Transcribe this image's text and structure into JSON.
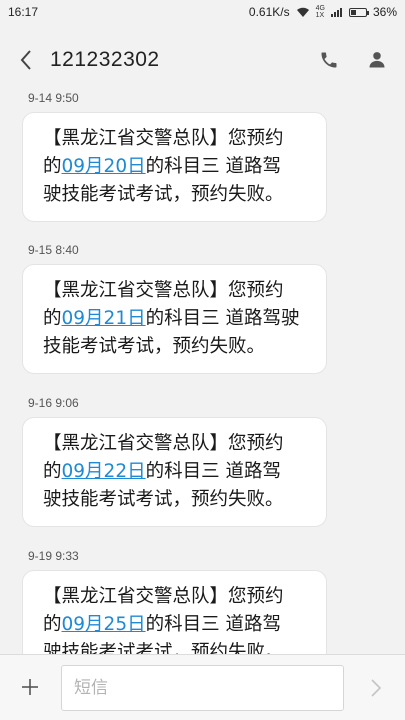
{
  "status_bar": {
    "time": "16:17",
    "net_speed": "0.61K/s",
    "net_type_top": "4G",
    "net_type_bottom": "1X",
    "battery": "36%",
    "battery_level": 0.36
  },
  "header": {
    "back_icon": "chevron-left-icon",
    "contact_number": "121232302",
    "call_icon": "phone-icon",
    "contact_icon": "person-icon"
  },
  "messages": [
    {
      "time": "9-14 9:50",
      "lines": [
        [
          "【黑龙江省交警总队】您预约"
        ],
        [
          "的",
          "09月20日",
          "的科目三 道路驾"
        ],
        [
          "驶技能考试考试，预约失败。"
        ]
      ]
    },
    {
      "time": "9-15 8:40",
      "lines": [
        [
          "【黑龙江省交警总队】您预约"
        ],
        [
          "的",
          "09月21日",
          "的科目三 道路驾驶"
        ],
        [
          "技能考试考试，预约失败。"
        ]
      ]
    },
    {
      "time": "9-16 9:06",
      "lines": [
        [
          "【黑龙江省交警总队】您预约"
        ],
        [
          "的",
          "09月22日",
          "的科目三 道路驾"
        ],
        [
          "驶技能考试考试，预约失败。"
        ]
      ]
    },
    {
      "time": "9-19 9:33",
      "lines": [
        [
          "【黑龙江省交警总队】您预约"
        ],
        [
          "的",
          "09月25日",
          "的科目三 道路驾"
        ],
        [
          "驶技能考试考试，预约失败。"
        ]
      ]
    }
  ],
  "composer": {
    "add_icon": "plus-icon",
    "placeholder": "短信",
    "send_icon": "send-arrow-icon"
  },
  "colors": {
    "link": "#1e8ad6",
    "background": "#f2f2f2",
    "bubble": "#ffffff"
  }
}
